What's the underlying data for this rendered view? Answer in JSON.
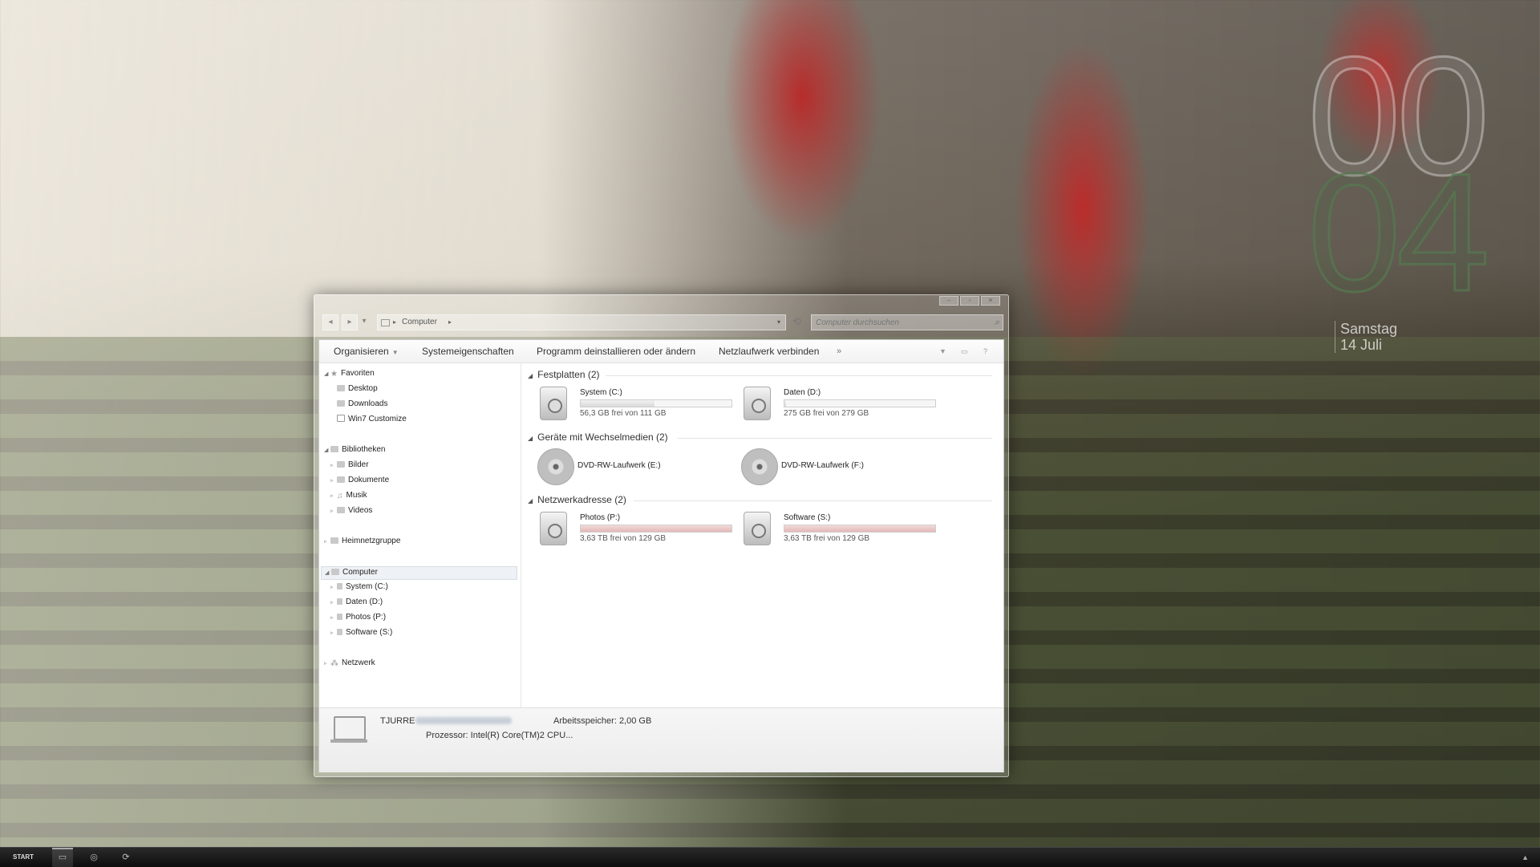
{
  "clock": {
    "hour": "00",
    "minute": "04",
    "weekday": "Samstag",
    "date": "14 Juli"
  },
  "window": {
    "caption_buttons": [
      "–",
      "▫",
      "✕"
    ],
    "address": {
      "crumb": "Computer",
      "separator": "▸"
    },
    "search": {
      "placeholder": "Computer durchsuchen"
    },
    "commands": {
      "organize": "Organisieren",
      "system_properties": "Systemeigenschaften",
      "uninstall": "Programm deinstallieren oder ändern",
      "map_drive": "Netzlaufwerk verbinden",
      "more": "»"
    },
    "nav": {
      "favorites": "Favoriten",
      "desktop": "Desktop",
      "downloads": "Downloads",
      "win7customize": "Win7 Customize",
      "libraries": "Bibliotheken",
      "pictures": "Bilder",
      "documents": "Dokumente",
      "music": "Musik",
      "videos": "Videos",
      "homegroup": "Heimnetzgruppe",
      "computer": "Computer",
      "drive_c": "System (C:)",
      "drive_d": "Daten (D:)",
      "drive_p": "Photos (P:)",
      "drive_s": "Software (S:)",
      "network": "Netzwerk"
    },
    "groups": {
      "hard_disks": "Festplatten (2)",
      "removable": "Geräte mit Wechselmedien (2)",
      "network": "Netzwerkadresse (2)"
    },
    "drives": {
      "c": {
        "name": "System (C:)",
        "free": "56,3 GB frei von 111 GB",
        "used_fraction": 0.49
      },
      "d": {
        "name": "Daten (D:)",
        "free": "275 GB frei von 279 GB",
        "used_fraction": 0.01
      },
      "e": {
        "name": "DVD-RW-Laufwerk (E:)"
      },
      "f": {
        "name": "DVD-RW-Laufwerk (F:)"
      },
      "p": {
        "name": "Photos (P:)",
        "free": "3,63 TB frei von 129 GB",
        "used_fraction": 1.0
      },
      "s": {
        "name": "Software (S:)",
        "free": "3,63 TB frei von 129 GB",
        "used_fraction": 1.0
      }
    },
    "details": {
      "computer_name": "TJURRE",
      "memory_label": "Arbeitsspeicher:",
      "memory_value": "2,00 GB",
      "cpu_label": "Prozessor:",
      "cpu_value": "Intel(R) Core(TM)2 CPU..."
    }
  },
  "taskbar": {
    "start": "START",
    "tray_arrow": "▲"
  },
  "colors": {
    "accent_clock": "#5a7a55",
    "usage_bar_full": "#e3b8b8"
  }
}
